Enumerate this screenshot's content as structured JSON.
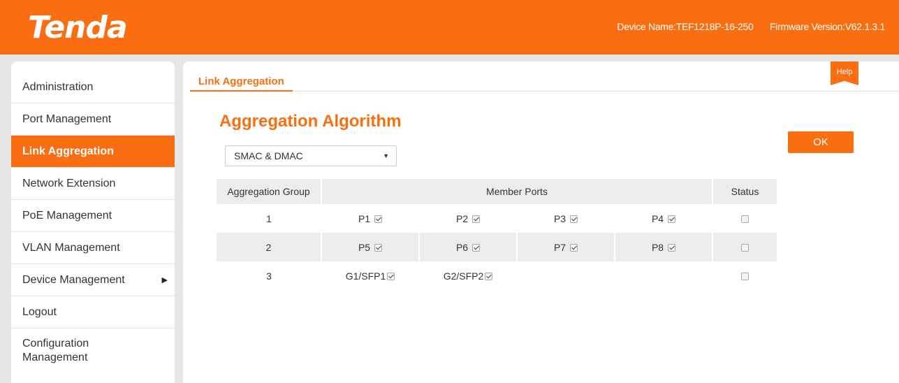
{
  "header": {
    "logo": "Tenda",
    "device_name_label": "Device Name:",
    "device_name": "TEF1218P-16-250",
    "firmware_label": "Firmware Version:",
    "firmware": "V62.1.3.1",
    "brand_color": "#f96e10"
  },
  "sidebar": {
    "items": [
      {
        "label": "Administration"
      },
      {
        "label": "Port Management"
      },
      {
        "label": "Link Aggregation",
        "active": true
      },
      {
        "label": "Network Extension"
      },
      {
        "label": "PoE Management"
      },
      {
        "label": "VLAN Management"
      },
      {
        "label": "Device Management",
        "has_submenu": true
      },
      {
        "label": "Logout"
      },
      {
        "label": "Configuration Management"
      }
    ]
  },
  "main": {
    "tab": "Link Aggregation",
    "help_label": "Help",
    "section_title": "Aggregation Algorithm",
    "algorithm_selected": "SMAC & DMAC",
    "ok_label": "OK",
    "table": {
      "headers": [
        "Aggregation Group",
        "Member Ports",
        "Status"
      ],
      "rows": [
        {
          "group": "1",
          "ports": [
            {
              "name": "P1",
              "checked": true
            },
            {
              "name": "P2",
              "checked": true
            },
            {
              "name": "P3",
              "checked": true
            },
            {
              "name": "P4",
              "checked": true
            }
          ],
          "status_checked": false
        },
        {
          "group": "2",
          "ports": [
            {
              "name": "P5",
              "checked": true
            },
            {
              "name": "P6",
              "checked": true
            },
            {
              "name": "P7",
              "checked": true
            },
            {
              "name": "P8",
              "checked": true
            }
          ],
          "status_checked": false
        },
        {
          "group": "3",
          "ports": [
            {
              "name": "G1/SFP1",
              "checked": true
            },
            {
              "name": "G2/SFP2",
              "checked": true
            }
          ],
          "status_checked": false
        }
      ]
    }
  }
}
